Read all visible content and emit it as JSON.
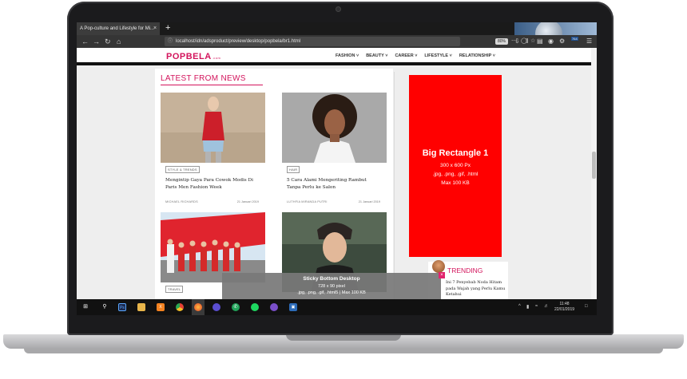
{
  "browser": {
    "tab_title": "A Pop-culture and Lifestyle for Mi...",
    "tab_close": "×",
    "new_tab": "+",
    "url": "localhost/idn/adsproduct/preview/desktop/popbela/br1.html",
    "zoom": "80%",
    "ext_badge": "764"
  },
  "site": {
    "logo": "POPBELA",
    "logo_sub": ".com",
    "nav": [
      "FASHION ˅",
      "BEAUTY ˅",
      "CAREER ˅",
      "LIFESTYLE ˅",
      "RELATIONSHIP ˅"
    ],
    "section_title": "LATEST FROM NEWS"
  },
  "articles": [
    {
      "tag": "STYLE & TRENDS",
      "title": "Mengintip Gaya Para Cowok Modis Di Paris Men Fashion Week",
      "author": "MICHAEL RICHARDS",
      "date": "21 Januari 2019"
    },
    {
      "tag": "HAIR",
      "title": "5 Cara Alami Mengeriting Rambut Tanpa Perlu ke Salon",
      "author": "LUTHFIA MIRANDA PUTRI",
      "date": "21 Januari 2019"
    },
    {
      "tag": "TRAVEL",
      "title": "",
      "author": "",
      "date": ""
    },
    {
      "tag": "",
      "title": "",
      "author": "",
      "date": ""
    }
  ],
  "ad": {
    "title": "Big Rectangle 1",
    "size": "300 x 600 Px",
    "formats": ".jpg, .png, .gif, .html",
    "max": "Max 100 KB"
  },
  "trending": {
    "title": "TRENDING",
    "item": "Ini 7 Penyebab Noda Hitam pada Wajah yang Perlu Kamu Ketahui"
  },
  "sticky": {
    "title": "Sticky Bottom Desktop",
    "size": "728 x 90 pixel",
    "formats": ".jpg, .png, .gif, .html5 | Max 100 KB",
    "close": "×"
  },
  "taskbar": {
    "time": "11:48",
    "date": "22/01/2019"
  },
  "colors": {
    "brand": "#d3145c",
    "ad_red": "#ff0000"
  }
}
